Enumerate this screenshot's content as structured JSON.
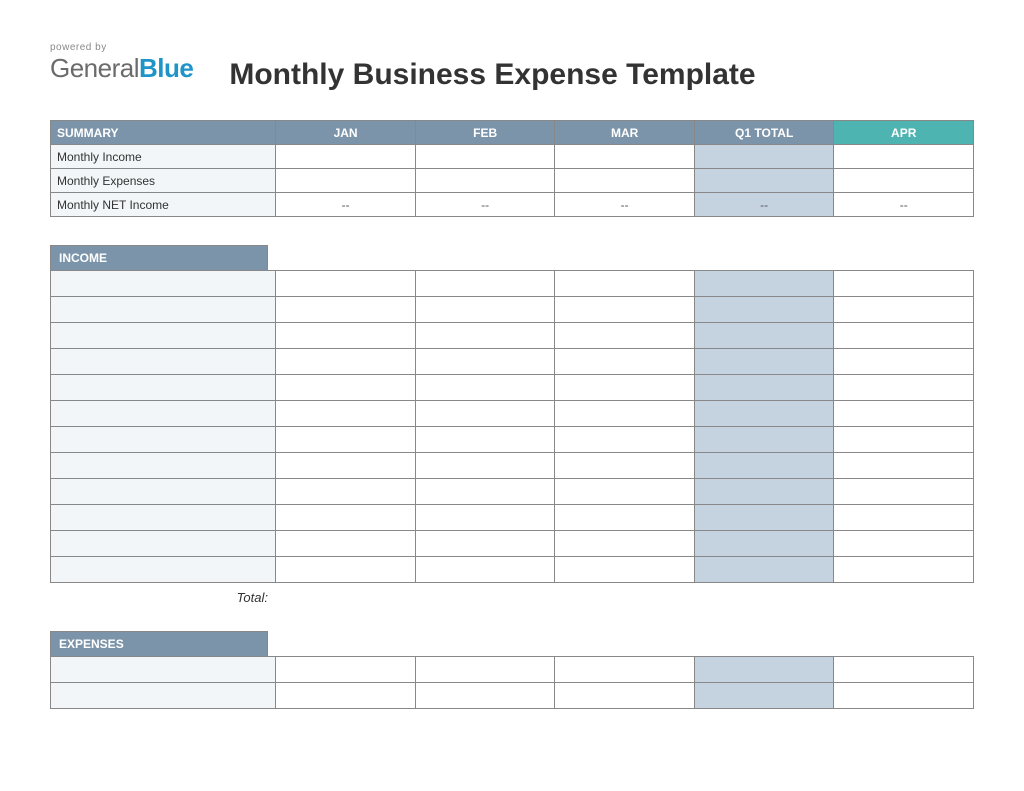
{
  "logo": {
    "powered": "powered by",
    "name1": "General",
    "name2": "Blue"
  },
  "title": "Monthly Business Expense Template",
  "summary": {
    "header": "SUMMARY",
    "cols": [
      "JAN",
      "FEB",
      "MAR",
      "Q1 TOTAL",
      "APR"
    ],
    "rows": [
      {
        "label": "Monthly Income",
        "vals": [
          "",
          "",
          "",
          "",
          ""
        ]
      },
      {
        "label": "Monthly Expenses",
        "vals": [
          "",
          "",
          "",
          "",
          ""
        ]
      },
      {
        "label": "Monthly NET Income",
        "vals": [
          "--",
          "--",
          "--",
          "--",
          "--"
        ]
      }
    ]
  },
  "income": {
    "header": "INCOME",
    "rowCount": 12,
    "totalLabel": "Total:"
  },
  "expenses": {
    "header": "EXPENSES",
    "rowCount": 2
  }
}
